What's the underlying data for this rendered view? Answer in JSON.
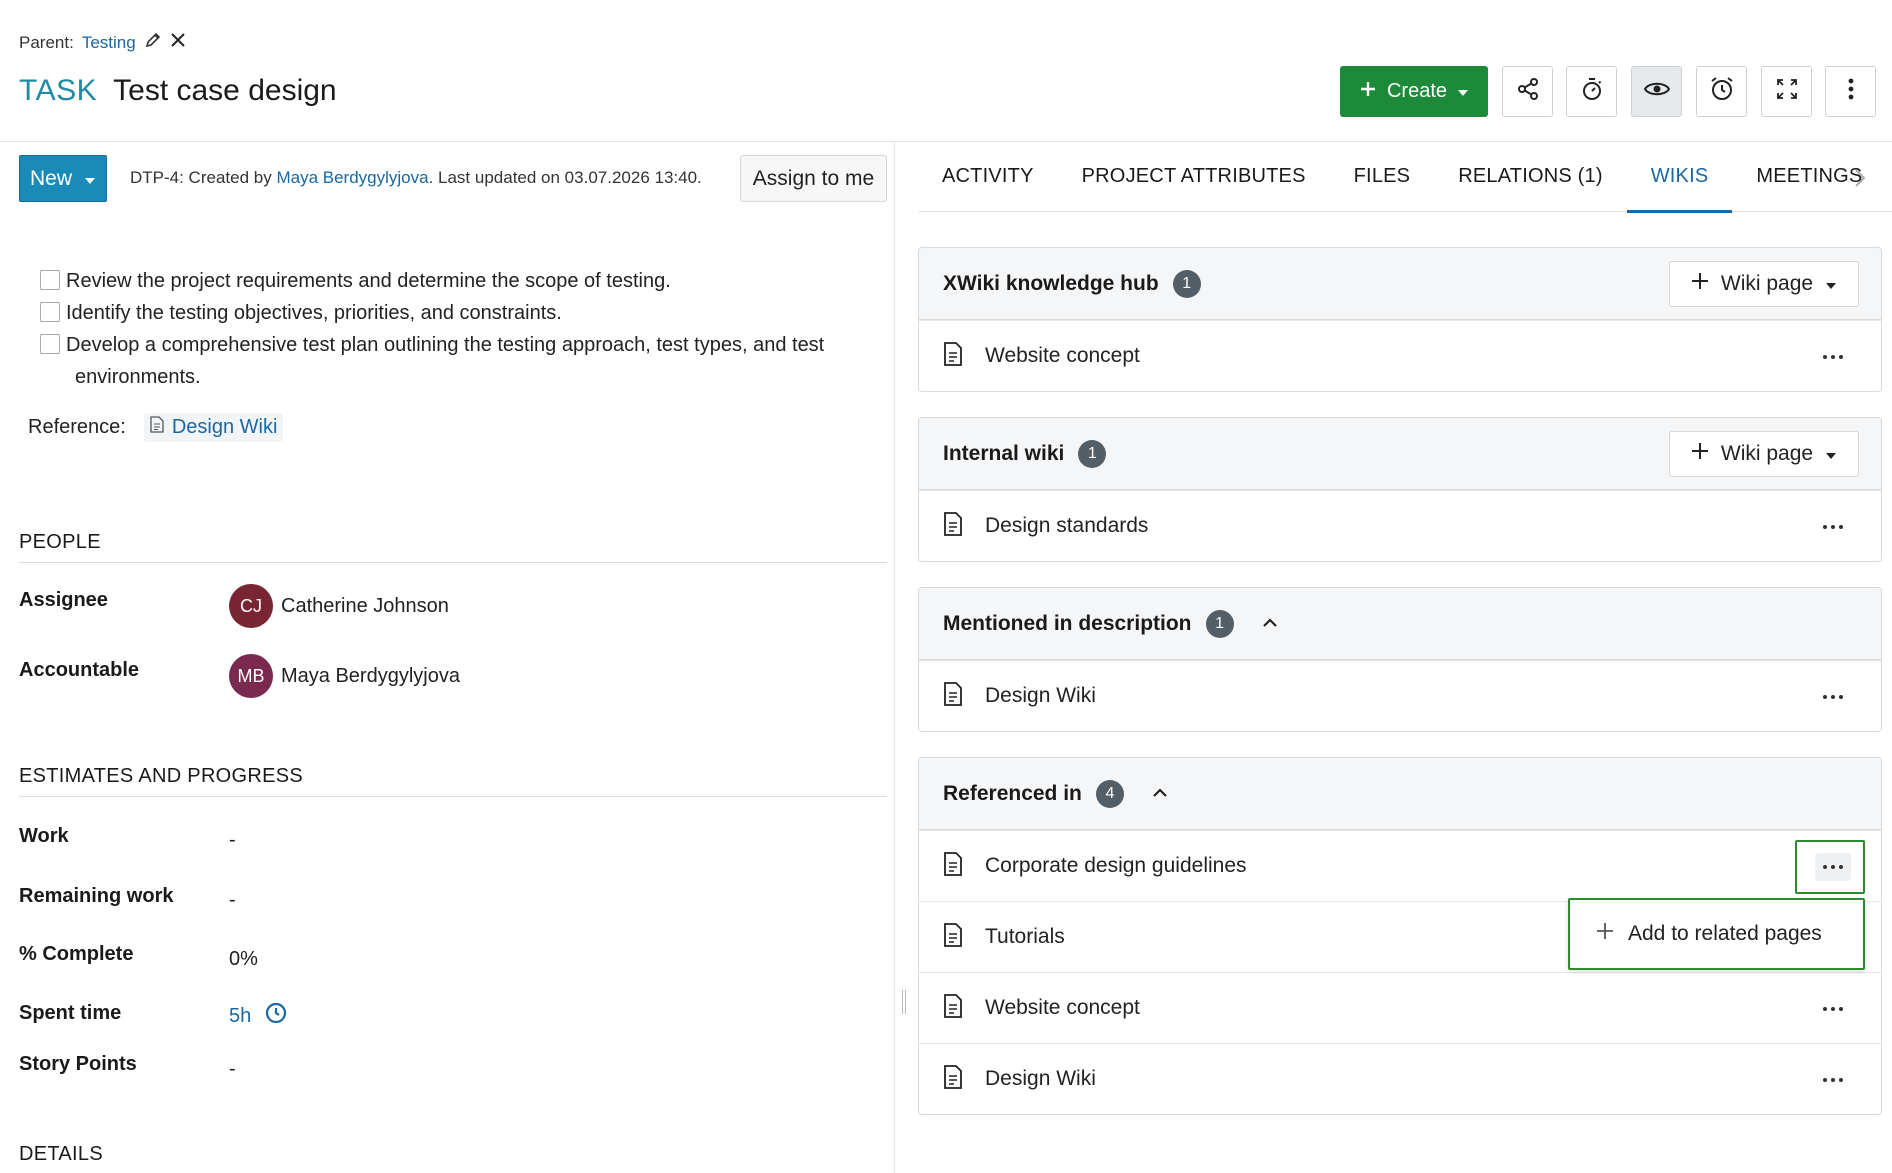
{
  "header": {
    "parent_label": "Parent:",
    "parent_link": "Testing",
    "type": "TASK",
    "subject": "Test case design",
    "create_label": "Create"
  },
  "status": {
    "label": "New"
  },
  "meta": {
    "prefix": "DTP-4: Created by ",
    "author": "Maya Berdygylyjova",
    "suffix": ". Last updated on 03.07.2026 13:40."
  },
  "assign_label": "Assign to me",
  "checklist": [
    "Review the project requirements and determine the scope of testing.",
    "Identify the testing objectives, priorities, and constraints.",
    "Develop a comprehensive test plan outlining the testing approach, test types, and test",
    "environments."
  ],
  "reference": {
    "label": "Reference:",
    "link": "Design Wiki"
  },
  "people": {
    "title": "PEOPLE",
    "assignee_label": "Assignee",
    "assignee_initials": "CJ",
    "assignee_name": "Catherine Johnson",
    "accountable_label": "Accountable",
    "accountable_initials": "MB",
    "accountable_name": "Maya Berdygylyjova"
  },
  "estimates": {
    "title": "ESTIMATES AND PROGRESS",
    "work_label": "Work",
    "work_value": "-",
    "remaining_label": "Remaining work",
    "remaining_value": "-",
    "complete_label": "% Complete",
    "complete_value": "0%",
    "spent_label": "Spent time",
    "spent_value": "5h",
    "story_label": "Story Points",
    "story_value": "-"
  },
  "details_title": "DETAILS",
  "tabs": [
    "ACTIVITY",
    "PROJECT ATTRIBUTES",
    "FILES",
    "RELATIONS (1)",
    "WIKIS",
    "MEETINGS"
  ],
  "active_tab": "WIKIS",
  "wikis": {
    "wiki_page_label": "Wiki page",
    "cards": [
      {
        "title": "XWiki knowledge hub",
        "count": "1",
        "items": [
          "Website concept"
        ]
      },
      {
        "title": "Internal wiki",
        "count": "1",
        "items": [
          "Design standards"
        ]
      },
      {
        "title": "Mentioned in description",
        "count": "1",
        "items": [
          "Design Wiki"
        ]
      },
      {
        "title": "Referenced in",
        "count": "4",
        "items": [
          "Corporate design guidelines",
          "Tutorials",
          "Website concept",
          "Design Wiki"
        ]
      }
    ],
    "menu_item": "Add to related pages"
  },
  "colors": {
    "accent": "#1a67a3",
    "create_green": "#1d8a3a",
    "status_blue": "#1a8bb8",
    "focus_green": "#2e8a2e",
    "avatar_cj": "#7a2632",
    "avatar_mb": "#7a2a4e"
  }
}
